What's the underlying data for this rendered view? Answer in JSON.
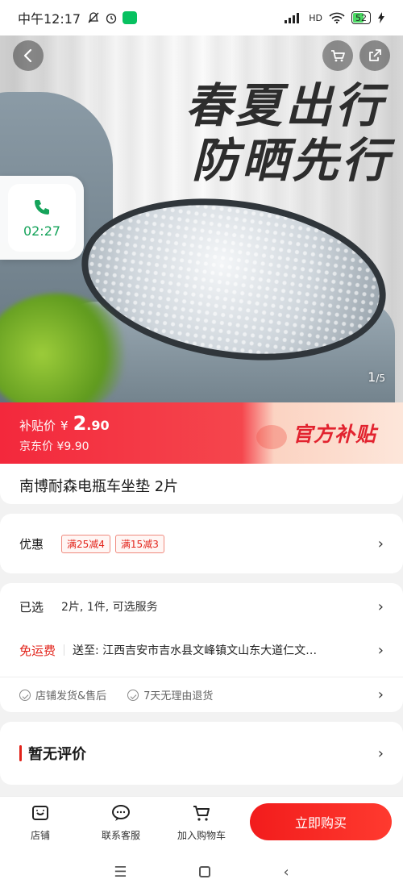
{
  "status": {
    "time": "中午12:17",
    "network_hd": "HD",
    "battery": "52"
  },
  "hero": {
    "slogan_line1": "春夏出行",
    "slogan_line2": "防晒先行",
    "page_current": "1",
    "page_total": "/5"
  },
  "call": {
    "duration": "02:27"
  },
  "price": {
    "subsidy_label": "补贴价",
    "currency": "¥",
    "subsidy_int": "2",
    "subsidy_dec": ".90",
    "jd_label": "京东价",
    "jd_price": "¥9.90",
    "badge": "官方补贴"
  },
  "product": {
    "title": "南博耐森电瓶车坐垫 2片"
  },
  "coupon": {
    "label": "优惠",
    "items": [
      "满25减4",
      "满15减3"
    ]
  },
  "spec": {
    "selected_label": "已选",
    "selected_value": "2片, 1件, 可选服务",
    "shipping_label": "免运费",
    "address": "送至: 江西吉安市吉水县文峰镇文山东大道仁文…",
    "services": [
      "店铺发货&售后",
      "7天无理由退货"
    ]
  },
  "review": {
    "title": "暂无评价"
  },
  "tabbar": {
    "store": "店铺",
    "service": "联系客服",
    "cart": "加入购物车",
    "buy": "立即购买"
  },
  "colors": {
    "brand_red": "#e2231a",
    "call_green": "#15a35a"
  }
}
